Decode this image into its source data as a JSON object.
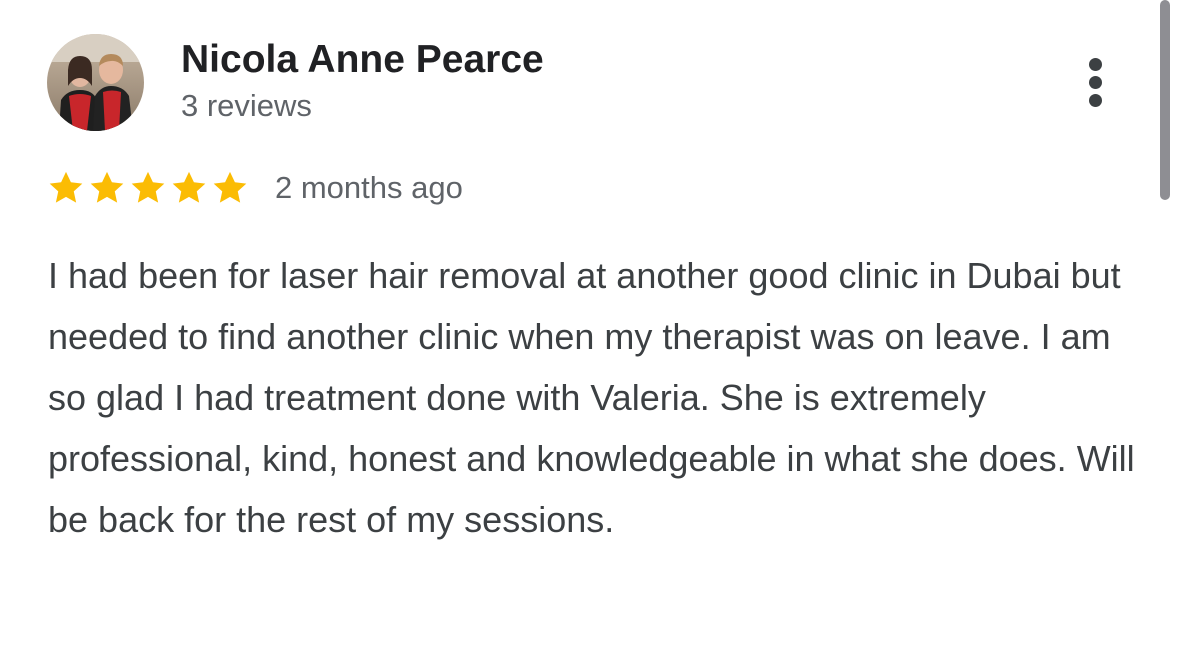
{
  "review": {
    "author_name": "Nicola Anne Pearce",
    "review_count": "3 reviews",
    "rating": 5,
    "rating_max": 5,
    "date": "2 months ago",
    "text": "I had been for laser hair removal at another good clinic in Dubai but needed to find another clinic when my therapist was on leave. I am so glad I had treatment done with Valeria. She is extremely professional, kind, honest and knowledgeable in what she does. Will be back for the rest of my sessions."
  },
  "icons": {
    "more": "more-vert-icon",
    "star": "star-icon"
  },
  "colors": {
    "star": "#fbbc04",
    "name": "#202124",
    "secondary_text": "#5f6368",
    "body_text": "#3c4043"
  }
}
